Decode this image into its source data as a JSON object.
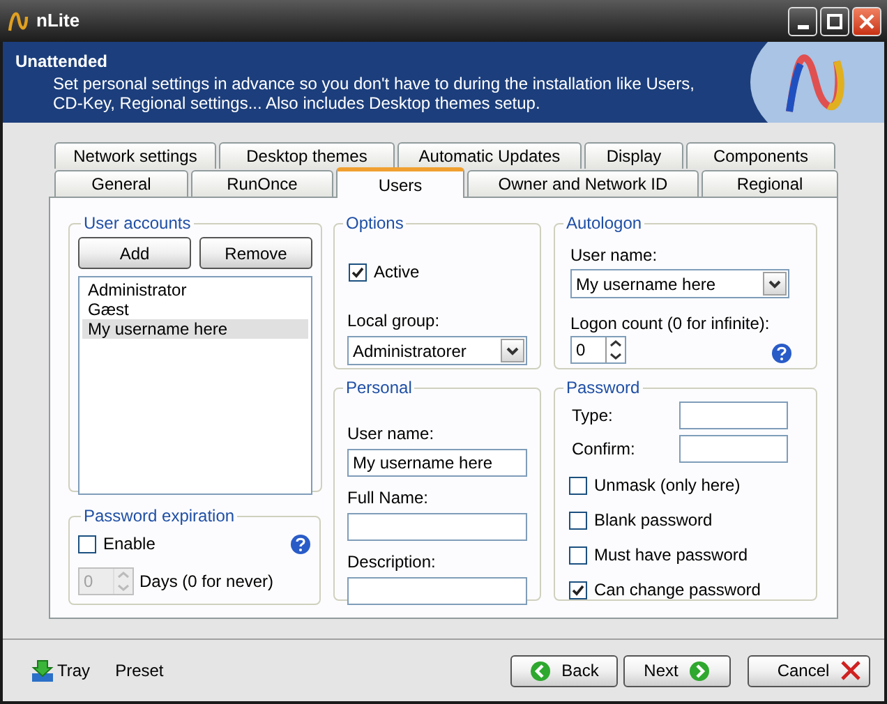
{
  "window": {
    "title": "nLite"
  },
  "header": {
    "title": "Unattended",
    "description": "Set personal settings in advance so you don't have to during the installation like Users, CD-Key, Regional settings... Also includes Desktop themes setup."
  },
  "tab_rows": [
    [
      {
        "label": "Network settings",
        "selected": false
      },
      {
        "label": "Desktop themes",
        "selected": false
      },
      {
        "label": "Automatic Updates",
        "selected": false
      },
      {
        "label": "Display",
        "selected": false
      },
      {
        "label": "Components",
        "selected": false
      }
    ],
    [
      {
        "label": "General",
        "selected": false
      },
      {
        "label": "RunOnce",
        "selected": false
      },
      {
        "label": "Users",
        "selected": true
      },
      {
        "label": "Owner and Network ID",
        "selected": false
      },
      {
        "label": "Regional",
        "selected": false
      }
    ]
  ],
  "user_accounts": {
    "title": "User accounts",
    "buttons": [
      "Add",
      "Remove"
    ],
    "items": [
      {
        "label": "Administrator",
        "selected": false
      },
      {
        "label": "Gæst",
        "selected": false
      },
      {
        "label": "My username here",
        "selected": true
      }
    ]
  },
  "password_expiration": {
    "title": "Password expiration",
    "enable": {
      "label": "Enable",
      "checked": false
    },
    "days": {
      "value": "0",
      "label": "Days (0 for never)",
      "disabled": true
    }
  },
  "options": {
    "title": "Options",
    "active": {
      "label": "Active",
      "checked": true
    },
    "local_group": {
      "label": "Local group:",
      "value": "Administratorer"
    }
  },
  "personal": {
    "title": "Personal",
    "fields": [
      {
        "label": "User name:",
        "value": "My username here"
      },
      {
        "label": "Full Name:"
      },
      {
        "label": "Description:"
      }
    ]
  },
  "autologon": {
    "title": "Autologon",
    "user_name": {
      "label": "User name:",
      "value": "My username here"
    },
    "logon_count": {
      "label": "Logon count (0 for infinite):",
      "value": "0"
    }
  },
  "password": {
    "title": "Password",
    "fields": [
      {
        "label": "Type:"
      },
      {
        "label": "Confirm:"
      }
    ],
    "checkboxes": [
      {
        "label": "Unmask (only here)",
        "checked": false
      },
      {
        "label": "Blank password",
        "checked": false
      },
      {
        "label": "Must have password",
        "checked": false
      },
      {
        "label": "Can change password",
        "checked": true
      }
    ]
  },
  "footer": {
    "links": [
      {
        "label": "Tray",
        "kind": "tray"
      },
      {
        "label": "Preset",
        "kind": "plain"
      }
    ],
    "buttons": [
      {
        "label": "Back",
        "kind": "back"
      },
      {
        "label": "Next",
        "kind": "next"
      },
      {
        "label": "Cancel",
        "kind": "cancel"
      }
    ]
  }
}
